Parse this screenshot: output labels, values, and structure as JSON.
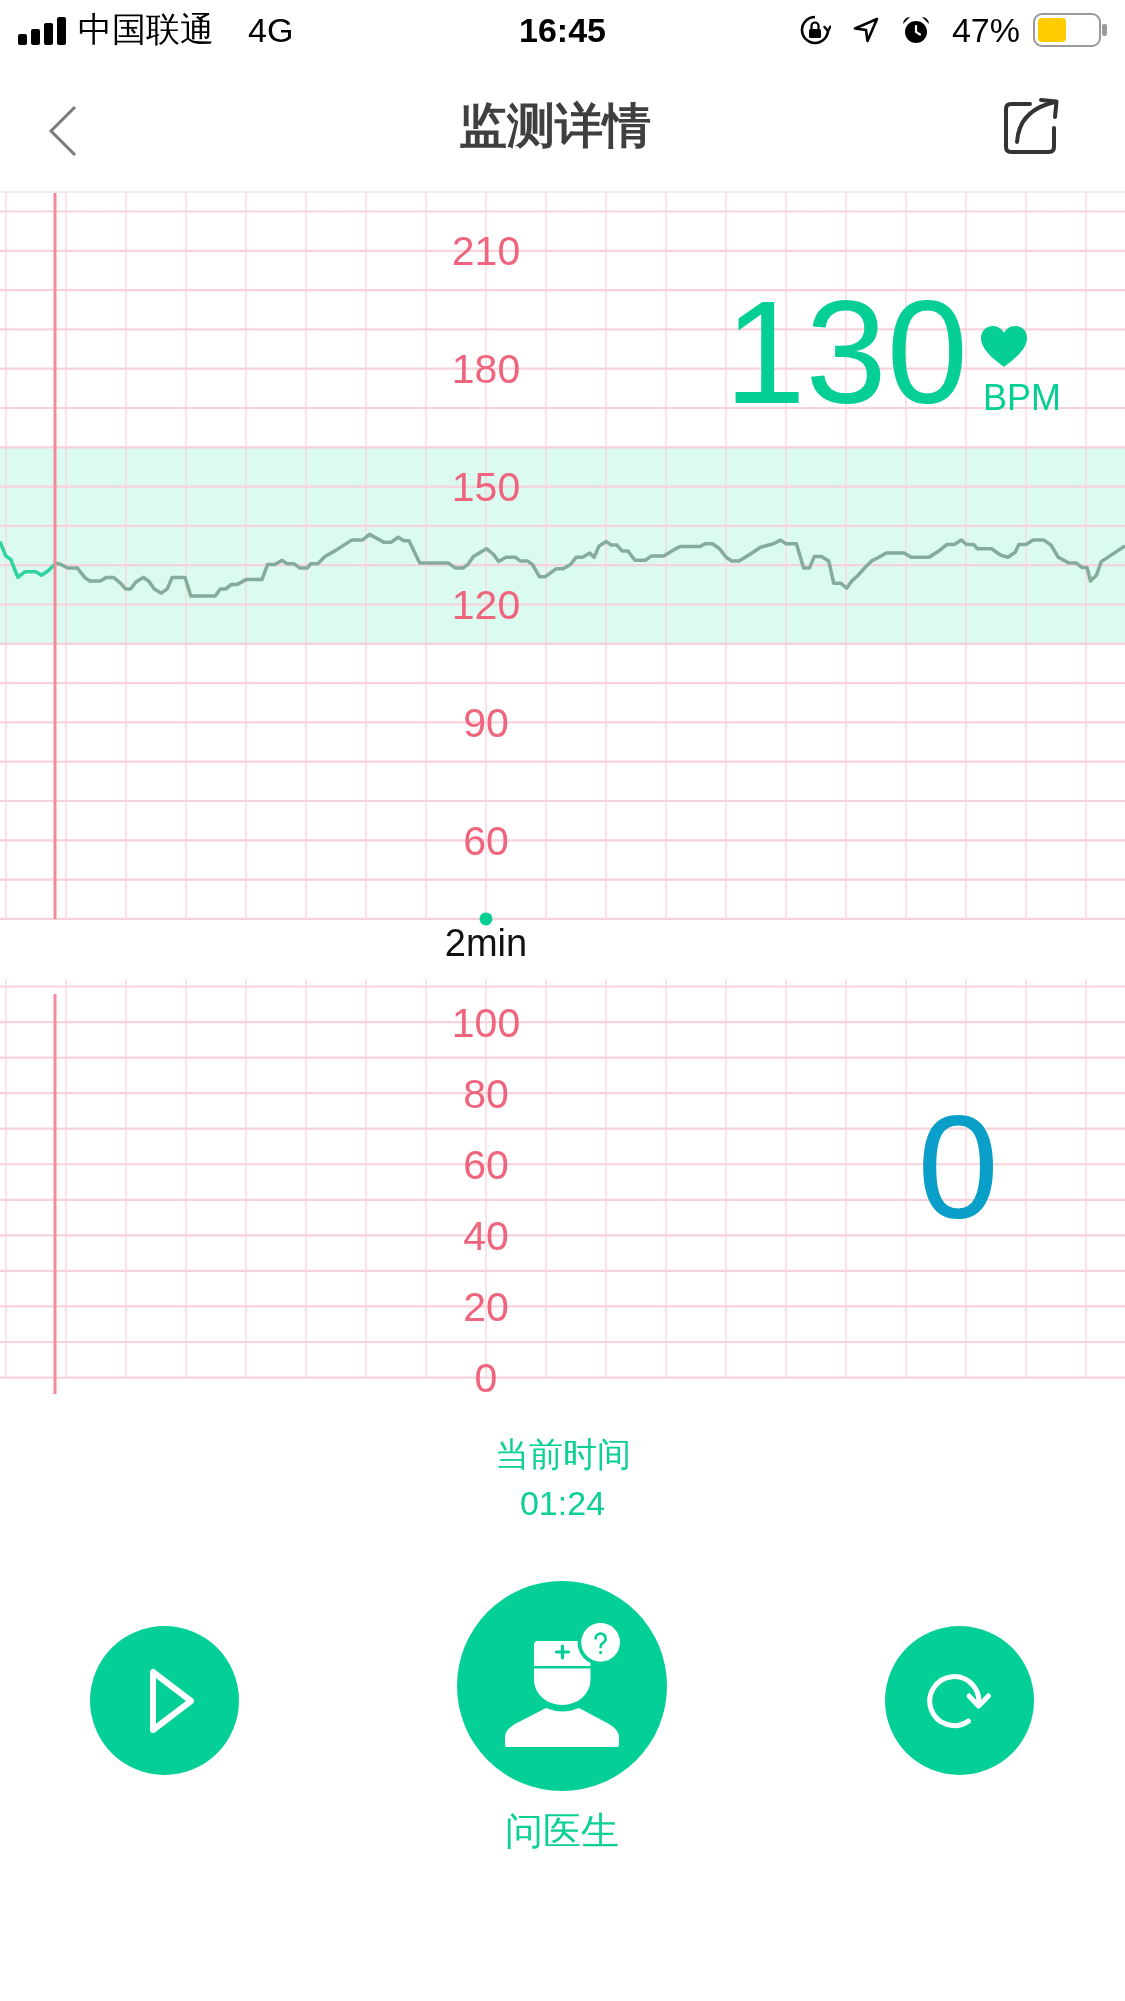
{
  "status_bar": {
    "carrier": "中国联通",
    "network": "4G",
    "time": "16:45",
    "battery": "47%"
  },
  "header": {
    "title": "监测详情"
  },
  "heart_rate_chart": {
    "y_labels": [
      "210",
      "180",
      "150",
      "120",
      "90",
      "60"
    ],
    "reading": "130",
    "unit": "BPM",
    "time_label": "2min"
  },
  "contraction_chart": {
    "y_labels": [
      "100",
      "80",
      "60",
      "40",
      "20",
      "0"
    ],
    "reading": "0"
  },
  "current_time": {
    "label": "当前时间",
    "value": "01:24"
  },
  "controls": [
    {
      "kind": "play"
    },
    {
      "kind": "ask_doctor",
      "label": "问医生"
    },
    {
      "kind": "replay"
    }
  ]
}
